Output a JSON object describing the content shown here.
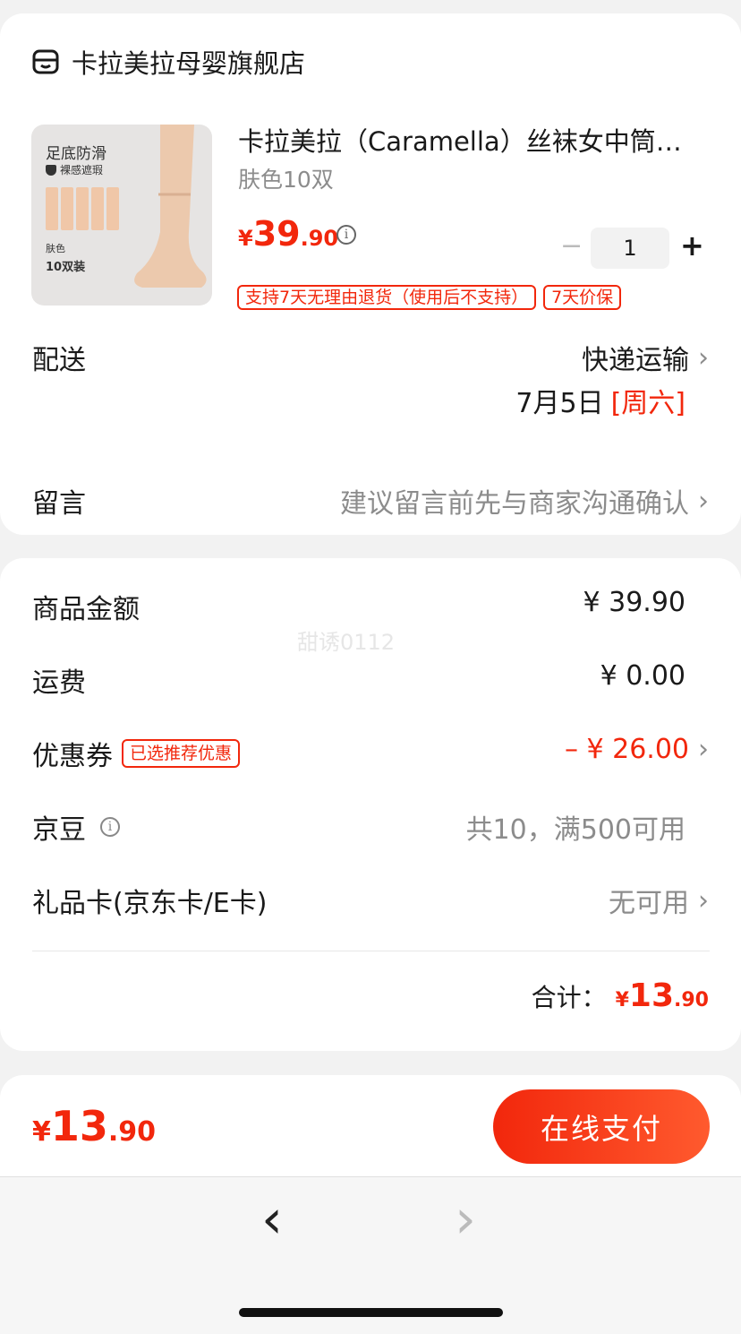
{
  "shop": {
    "icon": "shop-icon",
    "name": "卡拉美拉母婴旗舰店"
  },
  "product": {
    "thumb": {
      "line1": "足底防滑",
      "line2": "裸感遮瑕",
      "line3": "肤色",
      "line4": "10双装"
    },
    "title": "卡拉美拉（Caramella）丝袜女中筒…",
    "spec": "肤色10双",
    "price_symbol": "¥",
    "price_int": "39",
    "price_dec": ".90",
    "quantity": "1",
    "minus": "−",
    "plus": "+",
    "tags": [
      "支持7天无理由退货（使用后不支持）",
      "7天价保"
    ]
  },
  "delivery": {
    "label": "配送",
    "method": "快递运输",
    "date": "7月5日",
    "weekday": "[周六]"
  },
  "message": {
    "label": "留言",
    "placeholder": "建议留言前先与商家沟通确认"
  },
  "summary": {
    "goods_label": "商品金额",
    "goods_value": "¥ 39.90",
    "watermark": "甜诱0112",
    "shipping_label": "运费",
    "shipping_value": "¥ 0.00",
    "coupon_label": "优惠券",
    "coupon_tag": "已选推荐优惠",
    "coupon_value": "– ¥ 26.00",
    "jingdou_label": "京豆",
    "jingdou_value": "共10，满500可用",
    "giftcard_label": "礼品卡(京东卡/E卡)",
    "giftcard_value": "无可用",
    "total_label": "合计：",
    "total_symbol": "¥",
    "total_int": "13",
    "total_dec": ".90"
  },
  "footer": {
    "price_symbol": "¥",
    "price_int": "13",
    "price_dec": ".90",
    "pay_button": "在线支付"
  },
  "browser": {
    "back": "‹",
    "forward": "›"
  },
  "colors": {
    "accent": "#f2270c",
    "muted": "#8c8c8c"
  }
}
